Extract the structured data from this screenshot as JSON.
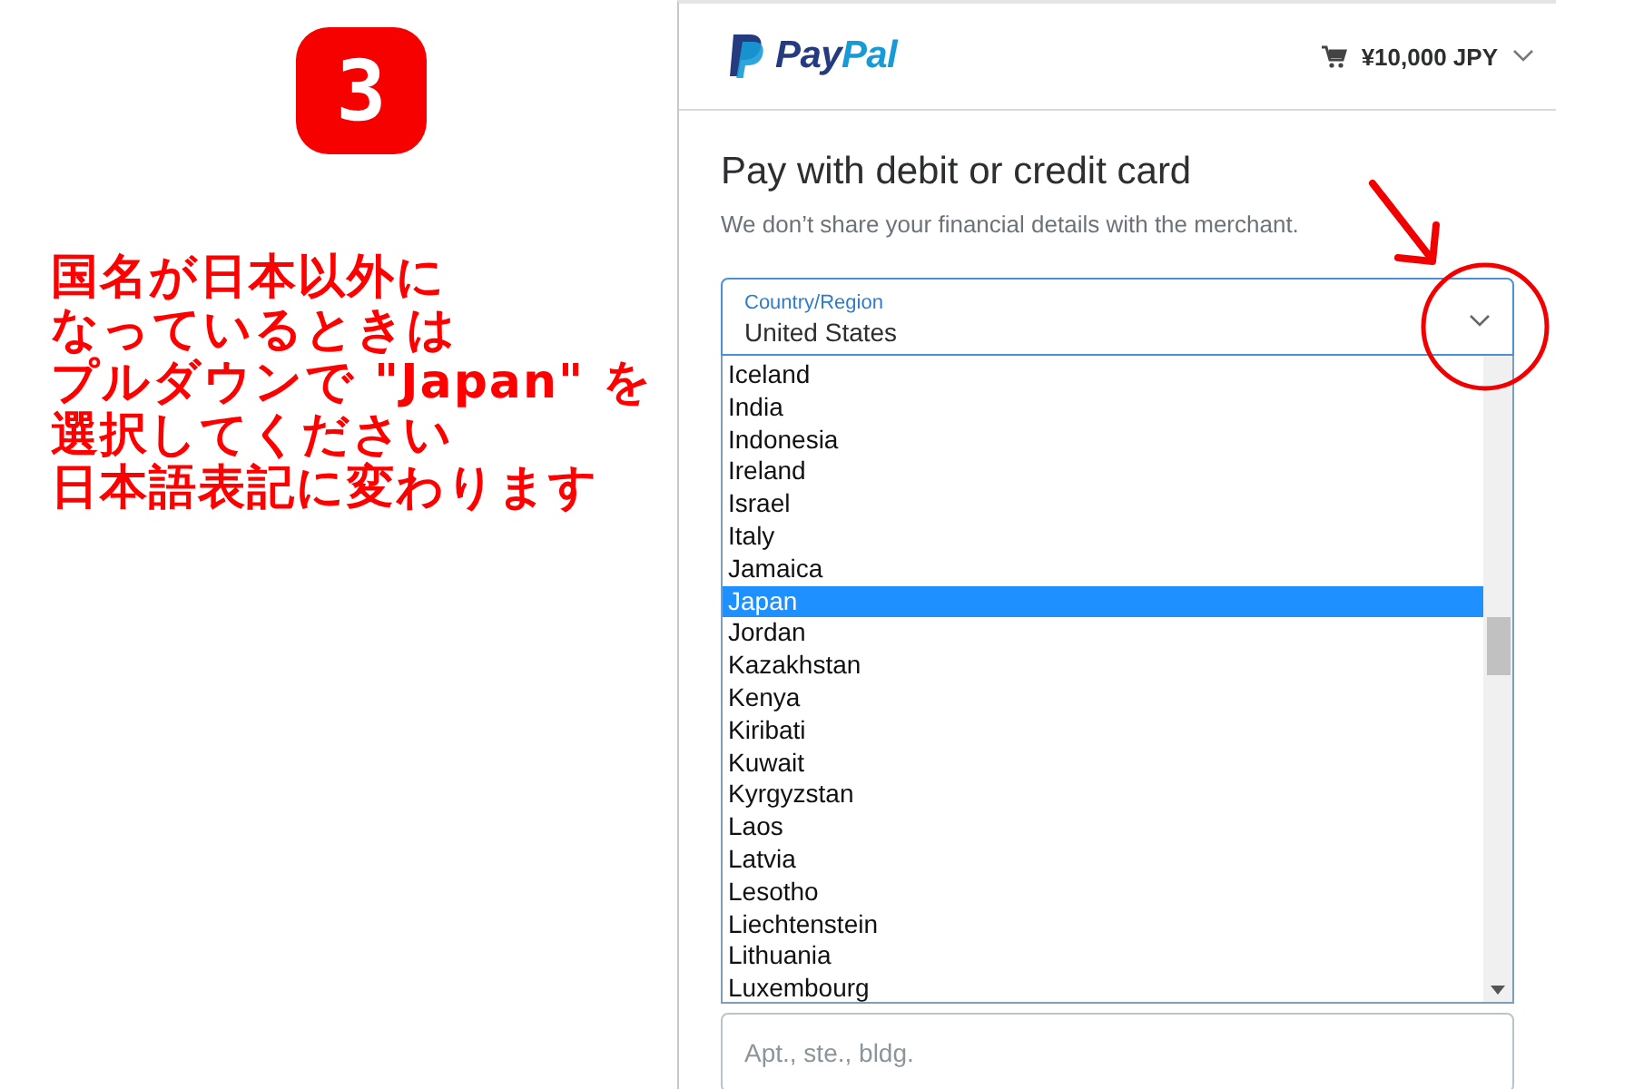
{
  "step_badge": "3",
  "instructions": [
    "国名が日本以外に",
    "なっているときは",
    "プルダウンで \"Japan\" を",
    "選択してください",
    "日本語表記に変わります"
  ],
  "header": {
    "logo_text": [
      "Pay",
      "Pal"
    ],
    "cart_total": "¥10,000 JPY"
  },
  "title": "Pay with debit or credit card",
  "subtitle": "We don’t share your financial details with the merchant.",
  "country_select": {
    "label": "Country/Region",
    "value": "United States",
    "expanded": true,
    "options": [
      {
        "label": "Iceland",
        "selected": false
      },
      {
        "label": "India",
        "selected": false
      },
      {
        "label": "Indonesia",
        "selected": false
      },
      {
        "label": "Ireland",
        "selected": false
      },
      {
        "label": "Israel",
        "selected": false
      },
      {
        "label": "Italy",
        "selected": false
      },
      {
        "label": "Jamaica",
        "selected": false
      },
      {
        "label": "Japan",
        "selected": true
      },
      {
        "label": "Jordan",
        "selected": false
      },
      {
        "label": "Kazakhstan",
        "selected": false
      },
      {
        "label": "Kenya",
        "selected": false
      },
      {
        "label": "Kiribati",
        "selected": false
      },
      {
        "label": "Kuwait",
        "selected": false
      },
      {
        "label": "Kyrgyzstan",
        "selected": false
      },
      {
        "label": "Laos",
        "selected": false
      },
      {
        "label": "Latvia",
        "selected": false
      },
      {
        "label": "Lesotho",
        "selected": false
      },
      {
        "label": "Liechtenstein",
        "selected": false
      },
      {
        "label": "Lithuania",
        "selected": false
      },
      {
        "label": "Luxembourg",
        "selected": false
      }
    ]
  },
  "apartment_field": {
    "placeholder": "Apt., ste., bldg."
  }
}
